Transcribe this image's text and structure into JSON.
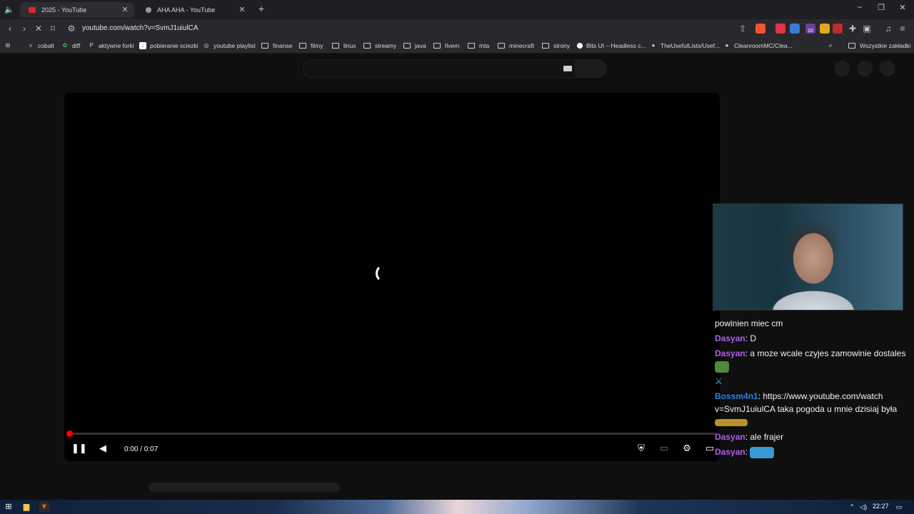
{
  "browser": {
    "tabs": [
      {
        "title": "2025 - YouTube",
        "favicon_color": "#e3242b"
      },
      {
        "title": "AHA AHA - YouTube",
        "favicon_color": "#9a9a9a"
      }
    ],
    "url": "youtube.com/watch?v=SvmJ1uiulCA",
    "bookmarks": [
      "cobalt",
      "diff",
      "aktywne forki",
      "pobieranie sciezki",
      "youtube playlist",
      "finanse",
      "filmy",
      "linux",
      "streamy",
      "java",
      "fivem",
      "mta",
      "minecraft",
      "strony",
      "Bits UI – Headless c...",
      "TheUsefulLists/Usef...",
      "CleanroomMC/Clea..."
    ],
    "all_bookmarks": "Wszystkie zakładki",
    "ext_badge": "10"
  },
  "player": {
    "time": "0:00 / 0:07",
    "progress_fraction": 0.0,
    "accent": "#ff0000"
  },
  "chat": [
    {
      "user": "",
      "text": "powinien miec cm"
    },
    {
      "user": "Dasyan",
      "text": ": D",
      "color": "#b05cf2"
    },
    {
      "user": "Dasyan",
      "text": ": a moze wcale czyjes zamowinie dostales",
      "color": "#b05cf2"
    },
    {
      "user": "Bossm4n1",
      "text": ": https://www.youtube.com/watch v=SvmJ1uiulCA taka pogoda u mnie dzisiaj była",
      "color": "#2f7ee0"
    },
    {
      "user": "Dasyan",
      "text": ": ale frajer",
      "color": "#b05cf2"
    },
    {
      "user": "Dasyan",
      "text": ":",
      "color": "#b05cf2"
    }
  ],
  "taskbar": {
    "time": "22:27"
  }
}
